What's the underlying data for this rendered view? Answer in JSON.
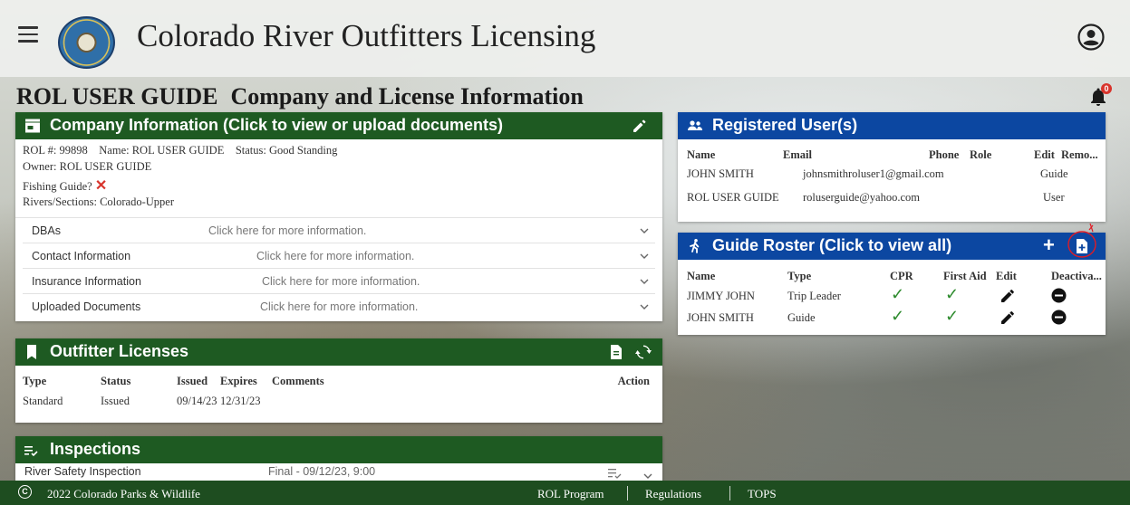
{
  "header": {
    "app_title": "Colorado River Outfitters Licensing"
  },
  "page": {
    "title_company": "ROL USER GUIDE",
    "title_section": "Company and License Information",
    "notification_count": "0"
  },
  "company": {
    "header": "Company Information (Click to view or upload documents)",
    "rol_number": "ROL #: 99898",
    "name": "Name: ROL USER GUIDE",
    "status": "Status: Good Standing",
    "owner": "Owner: ROL USER GUIDE",
    "fishing_guide_label": "Fishing Guide?",
    "fishing_guide_mark": "✕",
    "rivers": "Rivers/Sections: Colorado-Upper",
    "accordion": [
      {
        "label": "DBAs",
        "hint": "Click here for more information."
      },
      {
        "label": "Contact Information",
        "hint": "Click here for more information."
      },
      {
        "label": "Insurance Information",
        "hint": "Click here for more information."
      },
      {
        "label": "Uploaded Documents",
        "hint": "Click here for more information."
      }
    ]
  },
  "licenses": {
    "header": "Outfitter Licenses",
    "columns": [
      "Type",
      "Status",
      "Issued",
      "Expires",
      "Comments",
      "Action"
    ],
    "rows": [
      {
        "type": "Standard",
        "status": "Issued",
        "issued": "09/14/23",
        "expires": "12/31/23",
        "comments": ""
      }
    ]
  },
  "inspections": {
    "header": "Inspections",
    "rows": [
      {
        "name": "River Safety Inspection",
        "result": "Final - 09/12/23, 9:00"
      }
    ]
  },
  "users": {
    "header": "Registered User(s)",
    "columns": [
      "Name",
      "Email",
      "Phone",
      "Role",
      "Edit",
      "Remo..."
    ],
    "rows": [
      {
        "name": "JOHN SMITH",
        "email": "johnsmithroluser1@gmail.com",
        "phone": "",
        "role": "Guide"
      },
      {
        "name": "ROL USER GUIDE",
        "email": "roluserguide@yahoo.com",
        "phone": "",
        "role": "User"
      }
    ]
  },
  "roster": {
    "header": "Guide Roster (Click to view all)",
    "columns": [
      "Name",
      "Type",
      "CPR",
      "First Aid",
      "Edit",
      "Deactiva..."
    ],
    "rows": [
      {
        "name": "JIMMY JOHN",
        "type": "Trip Leader",
        "cpr": "✓",
        "first_aid": "✓"
      },
      {
        "name": "JOHN SMITH",
        "type": "Guide",
        "cpr": "✓",
        "first_aid": "✓"
      }
    ],
    "add_symbol": "+"
  },
  "footer": {
    "copyright_symbol": "C",
    "copyright": "2022 Colorado Parks & Wildlife",
    "links": [
      "ROL Program",
      "Regulations",
      "TOPS"
    ]
  },
  "colors": {
    "green": "#1e5a22",
    "blue": "#0c47a1",
    "footer": "#1e4d20",
    "alert": "#d8342c",
    "check": "#2e8b2e"
  }
}
